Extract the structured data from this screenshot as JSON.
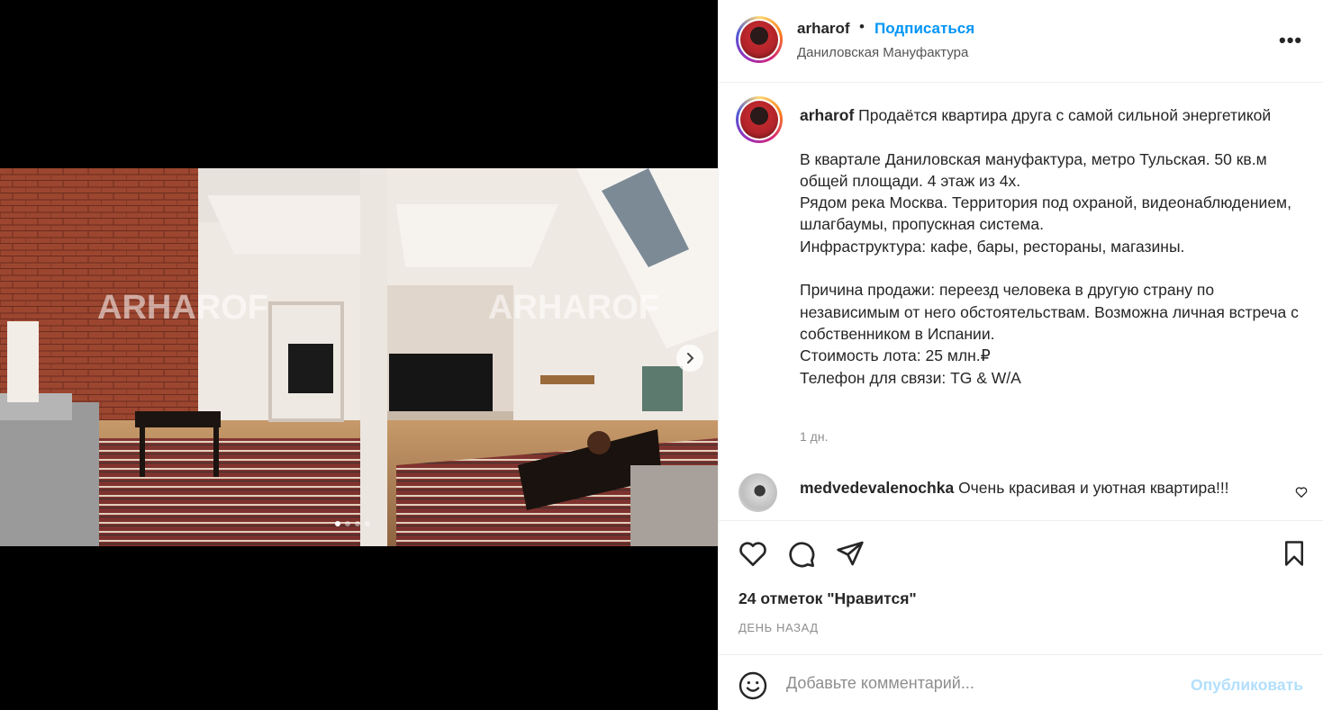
{
  "media": {
    "watermark_left": "ARHAROF",
    "watermark_right": "ARHAROF",
    "slides_total": 4,
    "active_slide": 1
  },
  "header": {
    "username": "arharof",
    "separator": "•",
    "follow_label": "Подписаться",
    "location": "Даниловская Мануфактура",
    "more_label": "•••"
  },
  "caption": {
    "username": "arharof",
    "text": " Продаётся квартира друга с самой сильной энергетикой\n\nВ квартале Даниловская мануфактура, метро Тульская. 50 кв.м общей площади. 4 этаж из 4х.\nРядом река Москва. Территория под охраной, видеонаблюдением, шлагбаумы, пропускная система.\nИнфраструктура: кафе, бары, рестораны, магазины.\n\nПричина продажи: переезд человека в другую страну по независимым от него обстоятельствам. Возможна личная встреча с собственником в Испании.\nСтоимость лота: 25 млн.₽\nТелефон для связи:                              TG & W/A",
    "time": "1 дн."
  },
  "comment": {
    "username": "medvedevalenochka",
    "text": " Очень красивая и уютная квартира!!!"
  },
  "likes": "24 отметок \"Нравится\"",
  "date": "ДЕНЬ НАЗАД",
  "add_comment": {
    "placeholder": "Добавьте комментарий...",
    "publish_label": "Опубликовать"
  },
  "icons": {
    "like": "heart-icon",
    "comment": "comment-icon",
    "share": "share-icon",
    "save": "bookmark-icon",
    "emoji": "emoji-icon",
    "next": "chevron-right-icon"
  },
  "colors": {
    "accent": "#0095f6",
    "publish_disabled": "#b2dffc",
    "muted": "#8e8e8e"
  }
}
